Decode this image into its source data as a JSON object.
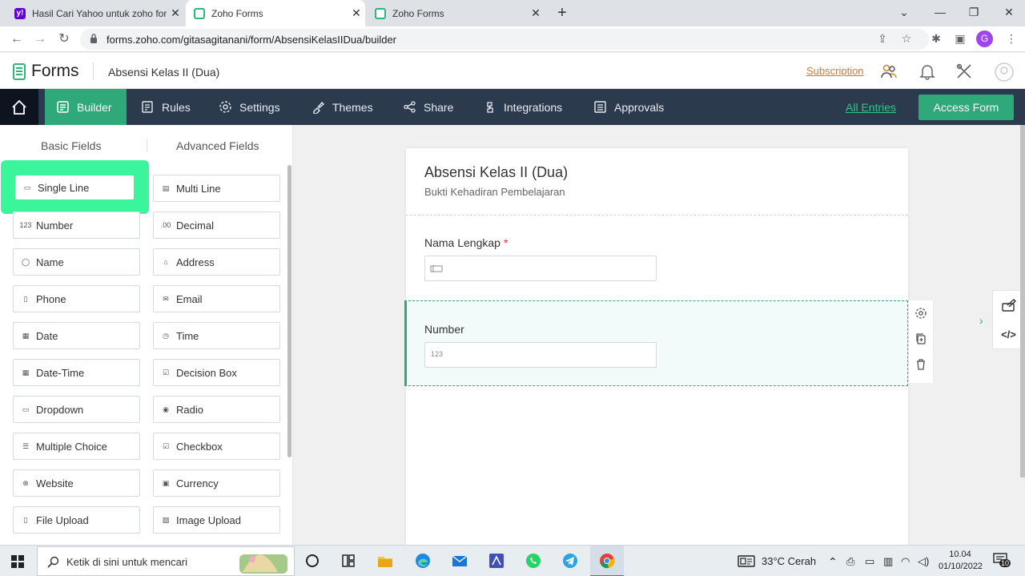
{
  "browser": {
    "tabs": [
      {
        "title": "Hasil Cari Yahoo untuk zoho form",
        "favicon": "yahoo-favicon",
        "active": false
      },
      {
        "title": "Zoho Forms",
        "favicon": "zoho-forms-favicon",
        "active": true
      },
      {
        "title": "Zoho Forms",
        "favicon": "zoho-forms-favicon",
        "active": false
      }
    ],
    "url": "forms.zoho.com/gitasagitanani/form/AbsensiKelasIIDua/builder",
    "profile_initial": "G"
  },
  "app": {
    "brand": "Forms",
    "form_name": "Absensi Kelas II (Dua)",
    "subscription_label": "Subscription"
  },
  "nav": {
    "items": [
      {
        "label": "Builder",
        "icon": "builder-icon",
        "active": true
      },
      {
        "label": "Rules",
        "icon": "rules-icon"
      },
      {
        "label": "Settings",
        "icon": "gear-icon"
      },
      {
        "label": "Themes",
        "icon": "paint-icon"
      },
      {
        "label": "Share",
        "icon": "share-icon"
      },
      {
        "label": "Integrations",
        "icon": "integrations-icon"
      },
      {
        "label": "Approvals",
        "icon": "approvals-icon"
      }
    ],
    "all_entries": "All Entries",
    "access_form": "Access Form"
  },
  "field_panel": {
    "tabs": [
      "Basic Fields",
      "Advanced Fields"
    ],
    "fields": [
      {
        "label": "Single Line",
        "icon": "single-line-icon"
      },
      {
        "label": "Multi Line",
        "icon": "multi-line-icon"
      },
      {
        "label": "Number",
        "icon": "number-icon"
      },
      {
        "label": "Decimal",
        "icon": "decimal-icon"
      },
      {
        "label": "Name",
        "icon": "person-icon"
      },
      {
        "label": "Address",
        "icon": "address-icon"
      },
      {
        "label": "Phone",
        "icon": "phone-icon"
      },
      {
        "label": "Email",
        "icon": "email-icon"
      },
      {
        "label": "Date",
        "icon": "calendar-icon"
      },
      {
        "label": "Time",
        "icon": "clock-icon"
      },
      {
        "label": "Date-Time",
        "icon": "date-time-icon"
      },
      {
        "label": "Decision Box",
        "icon": "checkbox-checked-icon"
      },
      {
        "label": "Dropdown",
        "icon": "dropdown-icon"
      },
      {
        "label": "Radio",
        "icon": "radio-icon"
      },
      {
        "label": "Multiple Choice",
        "icon": "multiple-choice-icon"
      },
      {
        "label": "Checkbox",
        "icon": "checkbox-list-icon"
      },
      {
        "label": "Website",
        "icon": "globe-icon"
      },
      {
        "label": "Currency",
        "icon": "currency-icon"
      },
      {
        "label": "File Upload",
        "icon": "file-upload-icon"
      },
      {
        "label": "Image Upload",
        "icon": "image-upload-icon"
      }
    ]
  },
  "form": {
    "title": "Absensi Kelas II (Dua)",
    "description": "Bukti Kehadiran Pembelajaran",
    "fields": [
      {
        "label": "Nama Lengkap",
        "required": true,
        "placeholder_icon": "single-line-icon"
      },
      {
        "label": "Number",
        "required": false,
        "placeholder_text": "123",
        "selected": true
      }
    ]
  },
  "taskbar": {
    "search_placeholder": "Ketik di sini untuk mencari",
    "weather": "33°C  Cerah",
    "time": "10.04",
    "date": "01/10/2022",
    "notification_count": "10"
  },
  "colors": {
    "accent": "#2fa87a",
    "nav_bg": "#2c3a4e",
    "highlight": "#3bf59c"
  }
}
